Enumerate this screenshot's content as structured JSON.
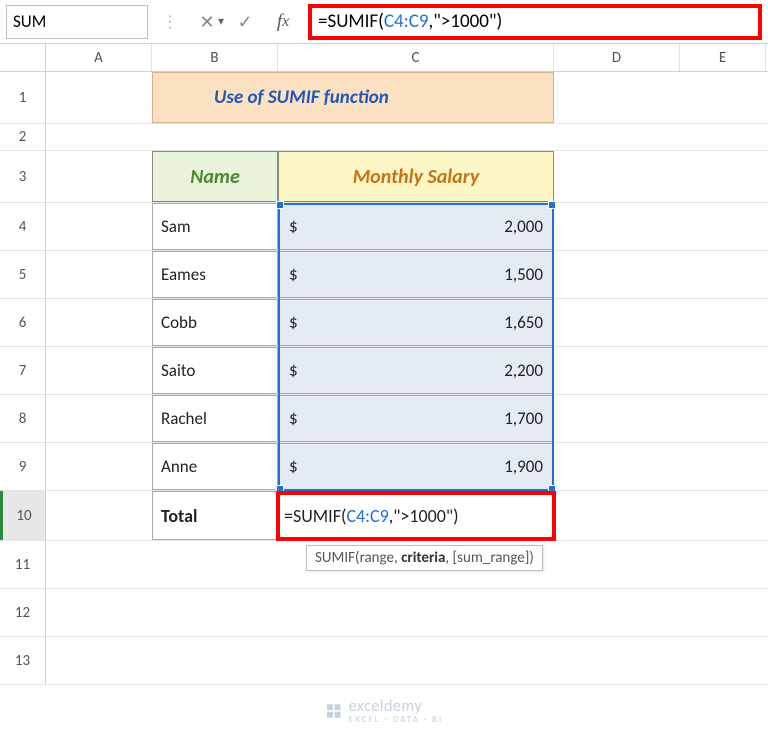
{
  "namebox": "SUM",
  "formula": {
    "prefix": "=SUMIF(",
    "ref": "C4:C9",
    "suffix": ",\">1000\")"
  },
  "columns": [
    "A",
    "B",
    "C",
    "D",
    "E"
  ],
  "rownums": [
    "1",
    "2",
    "3",
    "4",
    "5",
    "6",
    "7",
    "8",
    "9",
    "10",
    "11",
    "12",
    "13"
  ],
  "title": "Use of SUMIF function",
  "headers": {
    "name": "Name",
    "salary": "Monthly Salary"
  },
  "rowsdata": [
    {
      "name": "Sam",
      "salary": "2,000"
    },
    {
      "name": "Eames",
      "salary": "1,500"
    },
    {
      "name": "Cobb",
      "salary": "1,650"
    },
    {
      "name": "Saito",
      "salary": "2,200"
    },
    {
      "name": "Rachel",
      "salary": "1,700"
    },
    {
      "name": "Anne",
      "salary": "1,900"
    }
  ],
  "currency": "$",
  "total_label": "Total",
  "tooltip": {
    "fn": "SUMIF",
    "sig1": "(range, ",
    "bold": "criteria",
    "sig2": ", [sum_range])"
  },
  "watermark": {
    "text": "exceldemy",
    "sub": "EXCEL · DATA · BI"
  }
}
